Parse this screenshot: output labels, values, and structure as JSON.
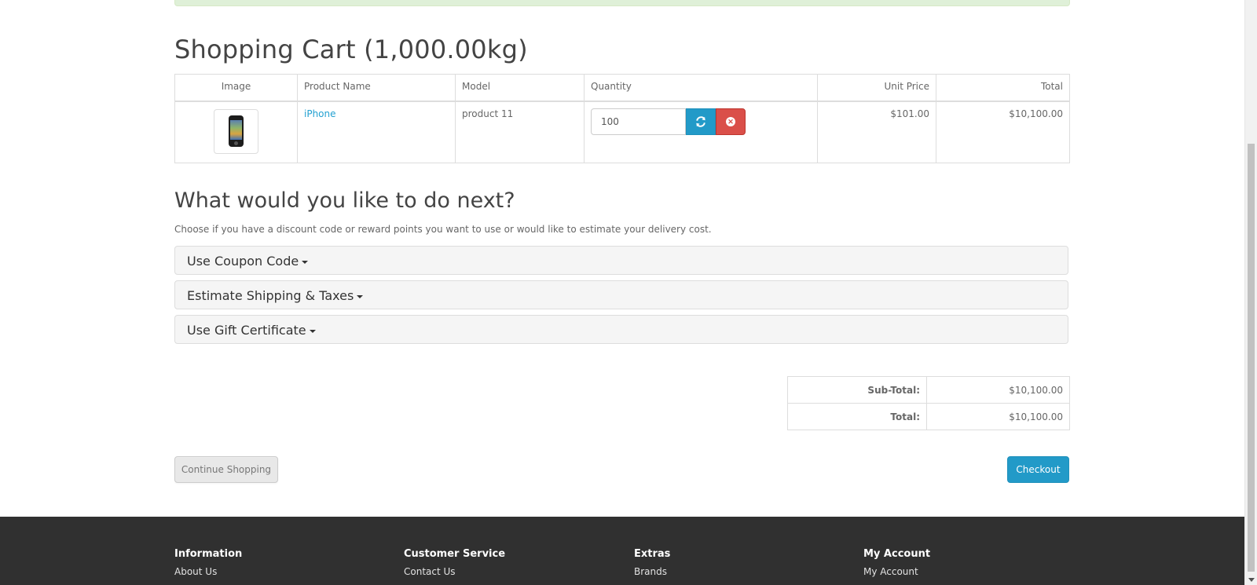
{
  "cart": {
    "title": "Shopping Cart  (1,000.00kg)",
    "columns": {
      "image": "Image",
      "product_name": "Product Name",
      "model": "Model",
      "quantity": "Quantity",
      "unit_price": "Unit Price",
      "total": "Total"
    },
    "items": [
      {
        "product_name": "iPhone",
        "model": "product 11",
        "quantity": "100",
        "unit_price": "$101.00",
        "total": "$10,100.00",
        "image_icon": "iphone-thumbnail"
      }
    ],
    "buttons": {
      "update_icon": "refresh-icon",
      "remove_icon": "remove-icon"
    }
  },
  "next": {
    "heading": "What would you like to do next?",
    "hint": "Choose if you have a discount code or reward points you want to use or would like to estimate your delivery cost.",
    "panels": [
      {
        "label": "Use Coupon Code"
      },
      {
        "label": "Estimate Shipping & Taxes"
      },
      {
        "label": "Use Gift Certificate"
      }
    ]
  },
  "totals": [
    {
      "label": "Sub-Total:",
      "value": "$10,100.00"
    },
    {
      "label": "Total:",
      "value": "$10,100.00"
    }
  ],
  "actions": {
    "continue_label": "Continue Shopping",
    "checkout_label": "Checkout"
  },
  "footer": {
    "columns": [
      {
        "heading": "Information",
        "link": "About Us"
      },
      {
        "heading": "Customer Service",
        "link": "Contact Us"
      },
      {
        "heading": "Extras",
        "link": "Brands"
      },
      {
        "heading": "My Account",
        "link": "My Account"
      }
    ]
  },
  "colors": {
    "link": "#23a1d1",
    "primary": "#229ac8",
    "danger": "#da4f49",
    "footer_bg": "#303030",
    "alert_bg": "#dff0d8"
  }
}
